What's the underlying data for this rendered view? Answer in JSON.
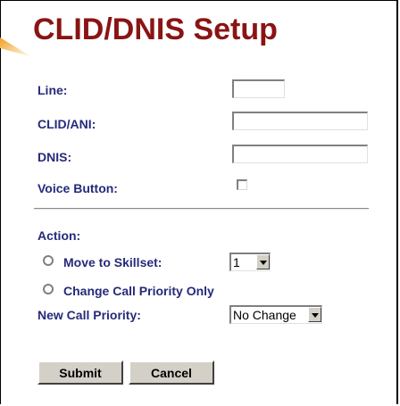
{
  "page": {
    "title": "CLID/DNIS Setup"
  },
  "form": {
    "line": {
      "label": "Line:",
      "value": ""
    },
    "clid": {
      "label": "CLID/ANI:",
      "value": ""
    },
    "dnis": {
      "label": "DNIS:",
      "value": ""
    },
    "voice_button": {
      "label": "Voice Button:",
      "checked": false
    },
    "action": {
      "label": "Action:",
      "move_to_skillset": {
        "label": "Move to Skillset:",
        "selected": false,
        "skillset_value": "1"
      },
      "change_priority_only": {
        "label": "Change Call Priority Only",
        "selected": false
      }
    },
    "new_call_priority": {
      "label": "New Call Priority:",
      "value": "No Change"
    }
  },
  "buttons": {
    "submit": "Submit",
    "cancel": "Cancel"
  },
  "colors": {
    "title": "#8a1414",
    "label": "#262a7a",
    "accent": "#e8a020"
  }
}
